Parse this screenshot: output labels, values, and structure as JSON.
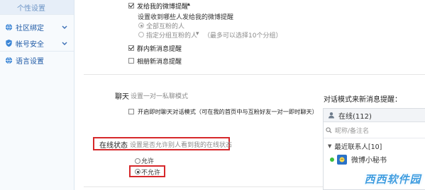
{
  "sidebar": {
    "items": [
      {
        "label": "个性设置",
        "icon": "none",
        "active": true
      },
      {
        "label": "社区绑定",
        "icon": "globe-icon",
        "active": false
      },
      {
        "label": "帐号安全",
        "icon": "shield-icon",
        "active": false
      },
      {
        "label": "语言设置",
        "icon": "globe-icon",
        "active": false
      }
    ]
  },
  "notify": {
    "weibo_reminder": {
      "label": "发给我的微博提醒",
      "checked": true
    },
    "weibo_reminder_desc": "设置收到哪些人发给我的微博提醒",
    "option_all_follow": "全部互粉的人",
    "option_group": "指定分组互粉的人",
    "option_group_hint": "（最多可以选择10个分组）",
    "group_message": {
      "label": "群内新消息提醒",
      "checked": true
    },
    "album_message": {
      "label": "相册新消息提醒",
      "checked": false
    }
  },
  "chat": {
    "title": "聊天",
    "desc": "设置一对一私聊模式",
    "instant_mode": {
      "label": "开启即时聊天对话模式（可在我的首页中与互粉好友一对一即时聊天）",
      "checked": false
    }
  },
  "online_status": {
    "title": "在线状态",
    "desc": "设置是否允许别人看到我的在线状态",
    "options": [
      "允许",
      "不允许"
    ],
    "selected": "不允许"
  },
  "chat_panel": {
    "title": "对话模式来新消息提醒：",
    "online_label": "在线(112)",
    "search_placeholder": "昵称/备注名",
    "recent_label": "最近联系人[10]",
    "contact_name": "微博小秘书"
  },
  "watermark": {
    "text": "西西软件园"
  },
  "colors": {
    "accent": "#1f5aa6",
    "highlight": "#d6282b",
    "status_green": "#3cbf3c"
  }
}
